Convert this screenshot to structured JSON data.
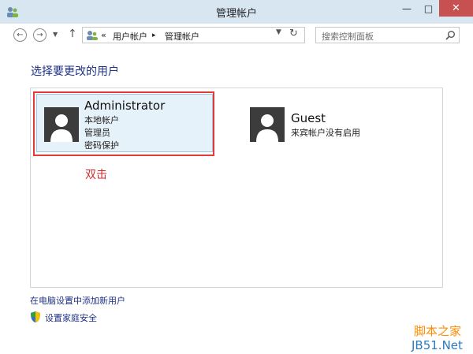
{
  "window": {
    "title": "管理帐户",
    "min_glyph": "—",
    "max_glyph": "□",
    "close_glyph": "✕"
  },
  "nav": {
    "back_glyph": "←",
    "forward_glyph": "→",
    "recent_glyph": "▼",
    "up_glyph": "↑",
    "breadcrumb_sep": "«",
    "breadcrumb": [
      "用户帐户",
      "管理帐户"
    ],
    "crumb_arrow": "▸",
    "dropdown_glyph": "▼",
    "refresh_glyph": "↻",
    "search_placeholder": "搜索控制面板"
  },
  "main": {
    "heading": "选择要更改的用户",
    "accounts": [
      {
        "name": "Administrator",
        "details": [
          "本地帐户",
          "管理员",
          "密码保护"
        ]
      },
      {
        "name": "Guest",
        "details": [
          "来宾帐户没有启用"
        ]
      }
    ],
    "annotation": "双击",
    "links": {
      "add_user": "在电脑设置中添加新用户",
      "family_safety": "设置家庭安全"
    }
  },
  "watermark": {
    "line1": "脚本之家",
    "line2": "JB51.Net"
  },
  "colors": {
    "accent": "#1e3287",
    "annotation_red": "#e43a3a",
    "selected_tile": "#e6f2fa"
  }
}
